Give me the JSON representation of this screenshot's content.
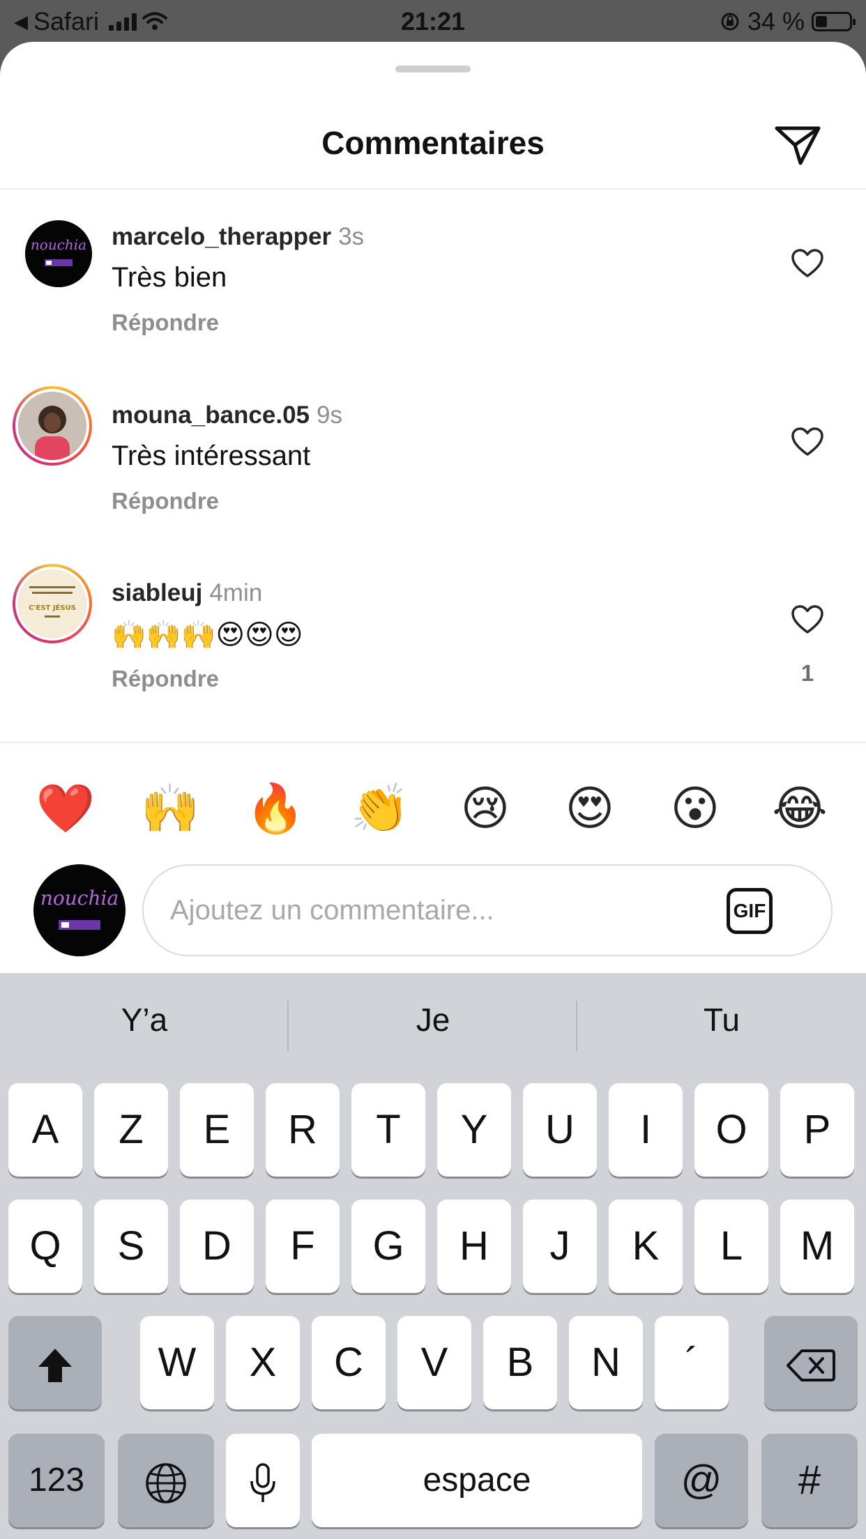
{
  "status_bar": {
    "back_app": "Safari",
    "time": "21:21",
    "battery_percent": "34 %",
    "battery_level": 0.34
  },
  "sheet": {
    "title": "Commentaires",
    "send_icon": "paper-plane-icon"
  },
  "comments": [
    {
      "username": "marcelo_therapper",
      "time": "3s",
      "text": "Très bien",
      "reply_label": "Répondre",
      "avatar_text": "nouchia",
      "likes": ""
    },
    {
      "username": "mouna_bance.05",
      "time": "9s",
      "text": "Très intéressant",
      "reply_label": "Répondre",
      "likes": ""
    },
    {
      "username": "siableuj",
      "time": "4min",
      "text": "🙌🙌🙌😍😍😍",
      "reply_label": "Répondre",
      "avatar_text": "C'EST JÉSUS",
      "likes": "1"
    }
  ],
  "emoji_bar": [
    "❤️",
    "🙌",
    "🔥",
    "👏",
    "😢",
    "😍",
    "😮",
    "😂"
  ],
  "composer": {
    "placeholder": "Ajoutez un commentaire...",
    "gif_label": "GIF",
    "avatar_text": "nouchia"
  },
  "keyboard": {
    "suggestions": [
      "Y’a",
      "Je",
      "Tu"
    ],
    "row1": [
      "A",
      "Z",
      "E",
      "R",
      "T",
      "Y",
      "U",
      "I",
      "O",
      "P"
    ],
    "row2": [
      "Q",
      "S",
      "D",
      "F",
      "G",
      "H",
      "J",
      "K",
      "L",
      "M"
    ],
    "row3": [
      "W",
      "X",
      "C",
      "V",
      "B",
      "N",
      "´"
    ],
    "numbers_label": "123",
    "space_label": "espace",
    "at_label": "@",
    "hash_label": "#"
  },
  "colors": {
    "status_bar": "#5a5a5a",
    "keyboard": "#d1d3d9",
    "muted_text": "#8e8e8e"
  }
}
